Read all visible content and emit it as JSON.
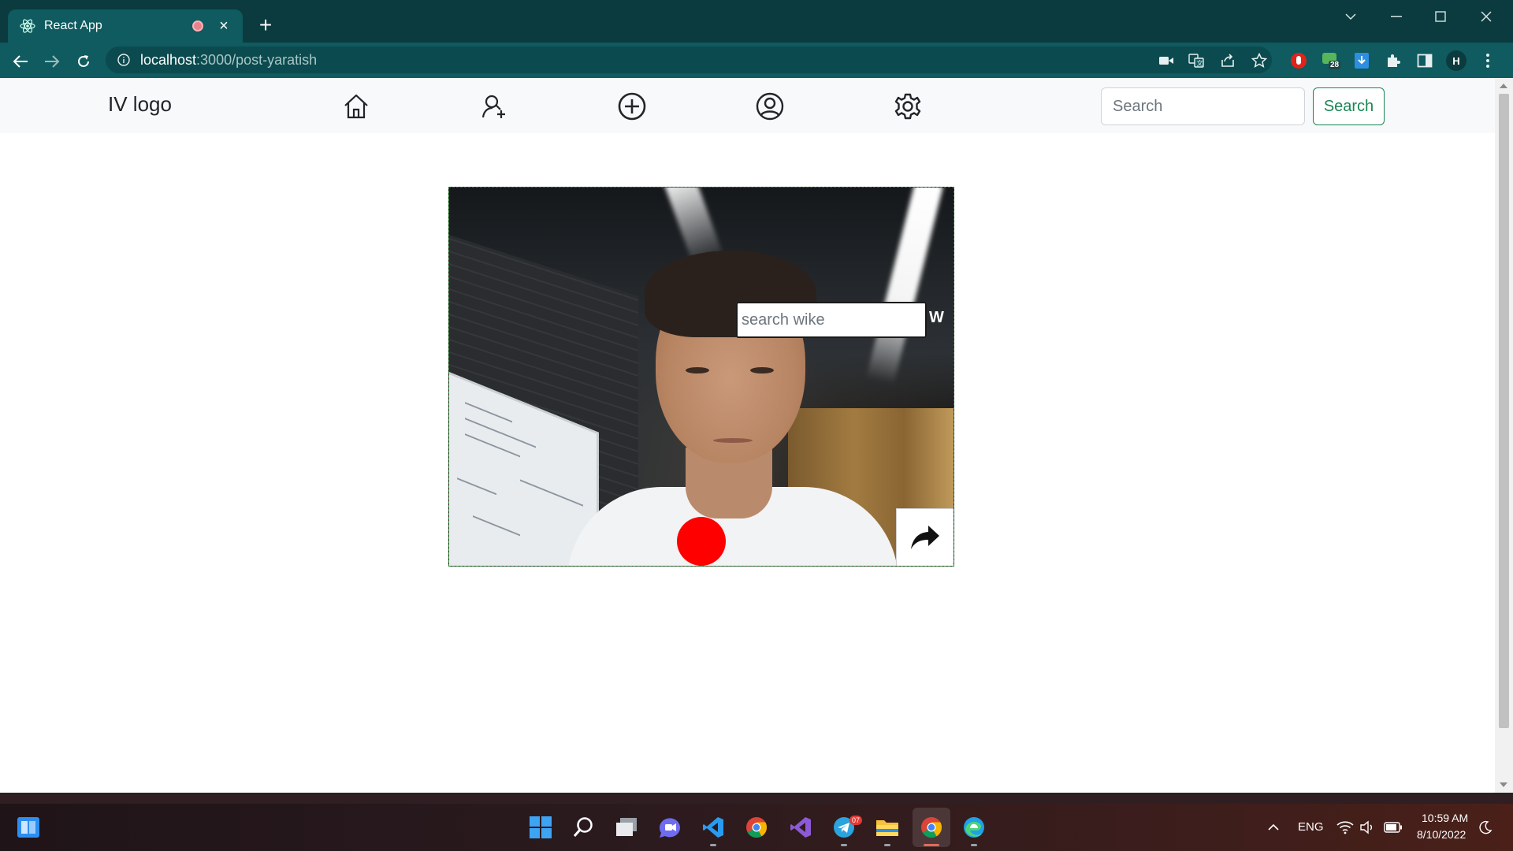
{
  "browser": {
    "tab_title": "React App",
    "url_host": "localhost",
    "url_path": ":3000/post-yaratish",
    "extension_badge": "28",
    "profile_initial": "H"
  },
  "page": {
    "brand": "IV logo",
    "nav_icons": [
      "home-icon",
      "user-search-icon",
      "add-circle-icon",
      "profile-icon",
      "settings-icon"
    ],
    "search": {
      "placeholder": "Search",
      "button_label": "Search"
    }
  },
  "camera": {
    "wiki_placeholder": "search wike",
    "wiki_suffix": "W",
    "record_color": "#ff0000"
  },
  "taskbar": {
    "language": "ENG",
    "time": "10:59 AM",
    "date": "8/10/2022",
    "telegram_badge": "07"
  },
  "colors": {
    "chrome_dark": "#0b3b3f",
    "chrome_toolbar": "#0f5b5f",
    "success": "#198754"
  }
}
